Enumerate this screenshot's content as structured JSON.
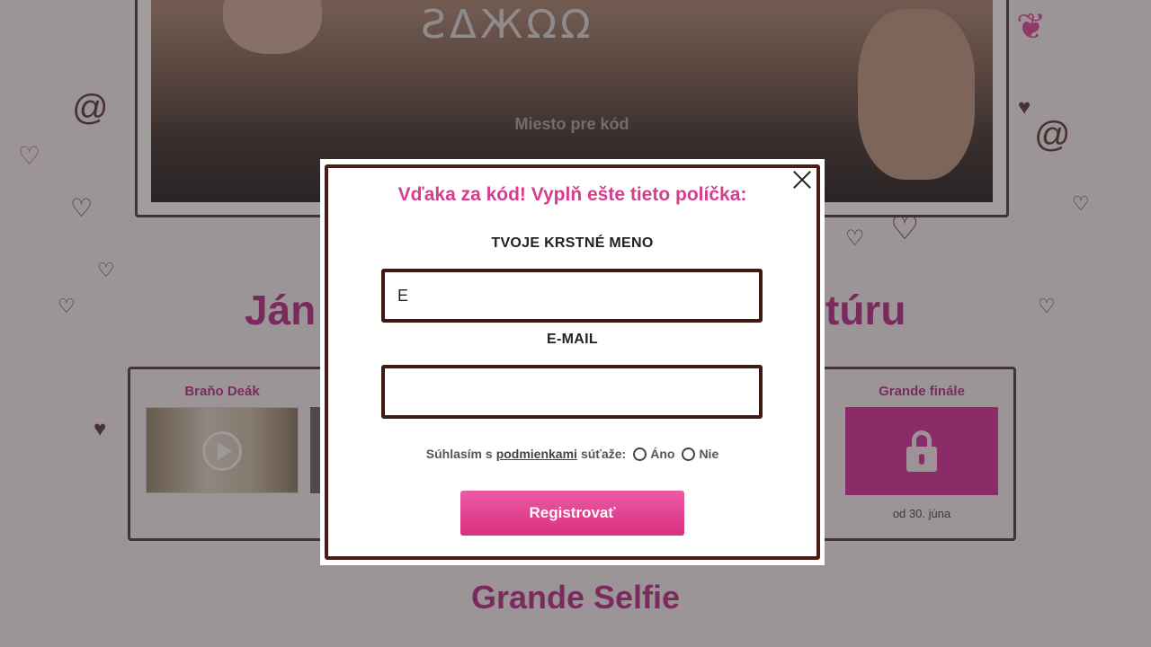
{
  "background": {
    "hero": {
      "code_glyphs": "ƧΔЖΩΩ",
      "code_placeholder": "Miesto pre kód"
    },
    "heading_left": "Ján",
    "heading_right": "túru",
    "videos": [
      {
        "title": "Braňo Deák",
        "locked": false
      },
      {
        "title": "Grande finále",
        "locked": true,
        "unlock_date": "od 30. júna"
      }
    ],
    "bottom_heading": "Grande Selfie"
  },
  "modal": {
    "title": "Vďaka za kód! Vyplň ešte tieto políčka:",
    "first_name": {
      "label": "TVOJE KRSTNÉ MENO",
      "value": "E"
    },
    "email": {
      "label": "E-MAIL",
      "value": ""
    },
    "consent": {
      "prefix": "Súhlasím s",
      "link": "podmienkami",
      "suffix": "súťaže:",
      "option_yes": "Áno",
      "option_no": "Nie"
    },
    "submit_label": "Registrovať"
  },
  "colors": {
    "accent_pink": "#d53d8f",
    "button_pink": "#e24a93",
    "frame_brown": "#4a1e14"
  }
}
